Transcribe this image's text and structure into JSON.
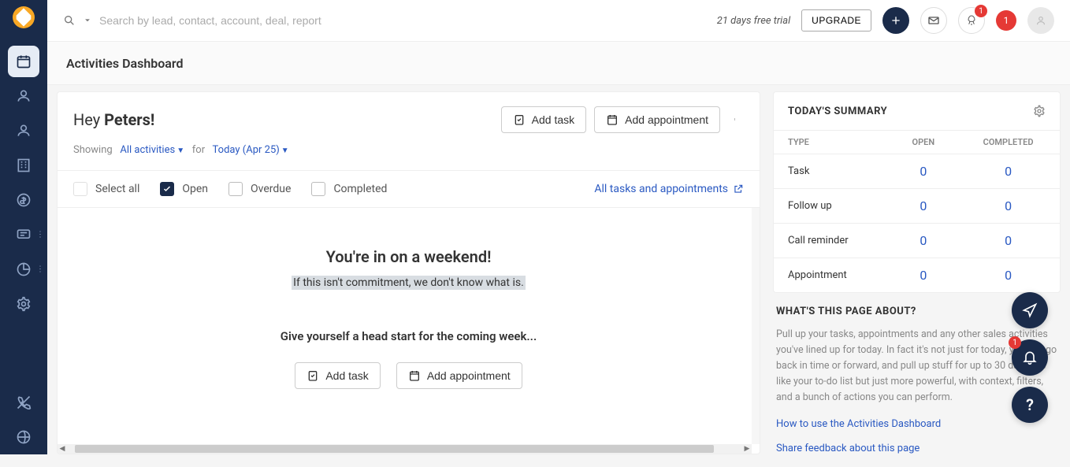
{
  "topbar": {
    "search_placeholder": "Search by lead, contact, account, deal, report",
    "trial_text": "21 days free trial",
    "upgrade_label": "UPGRADE",
    "rocket_badge": "1",
    "red_badge": "1"
  },
  "page": {
    "title": "Activities Dashboard"
  },
  "greeting": {
    "prefix": "Hey ",
    "name": "Peters!",
    "add_task_label": "Add task",
    "add_appointment_label": "Add appointment"
  },
  "filter": {
    "showing": "Showing",
    "activities": "All activities",
    "for": "for",
    "date": "Today (Apr 25)"
  },
  "checkboxes": {
    "select_all": "Select all",
    "open": "Open",
    "overdue": "Overdue",
    "completed": "Completed",
    "all_link": "All tasks and appointments"
  },
  "empty": {
    "title": "You're in on a weekend!",
    "subtitle": "If this isn't commitment, we don't know what is.",
    "head": "Give yourself a head start for the coming week...",
    "add_task": "Add task",
    "add_appointment": "Add appointment"
  },
  "summary": {
    "title": "TODAY'S SUMMARY",
    "cols": {
      "type": "TYPE",
      "open": "OPEN",
      "completed": "COMPLETED"
    },
    "rows": [
      {
        "type": "Task",
        "open": "0",
        "completed": "0"
      },
      {
        "type": "Follow up",
        "open": "0",
        "completed": "0"
      },
      {
        "type": "Call reminder",
        "open": "0",
        "completed": "0"
      },
      {
        "type": "Appointment",
        "open": "0",
        "completed": "0"
      }
    ]
  },
  "about": {
    "title": "WHAT'S THIS PAGE ABOUT?",
    "text": "Pull up your tasks, appointments and any other sales activities you've lined up for today. In fact it's not just for today, you can go back in time or forward, and pull up stuff for up to 30 days. It's like your to-do list but just more powerful, with context, filters, and a bunch of actions you can perform.",
    "link1": "How to use the Activities Dashboard",
    "link2": "Share feedback about this page"
  },
  "float": {
    "bell_badge": "1"
  }
}
